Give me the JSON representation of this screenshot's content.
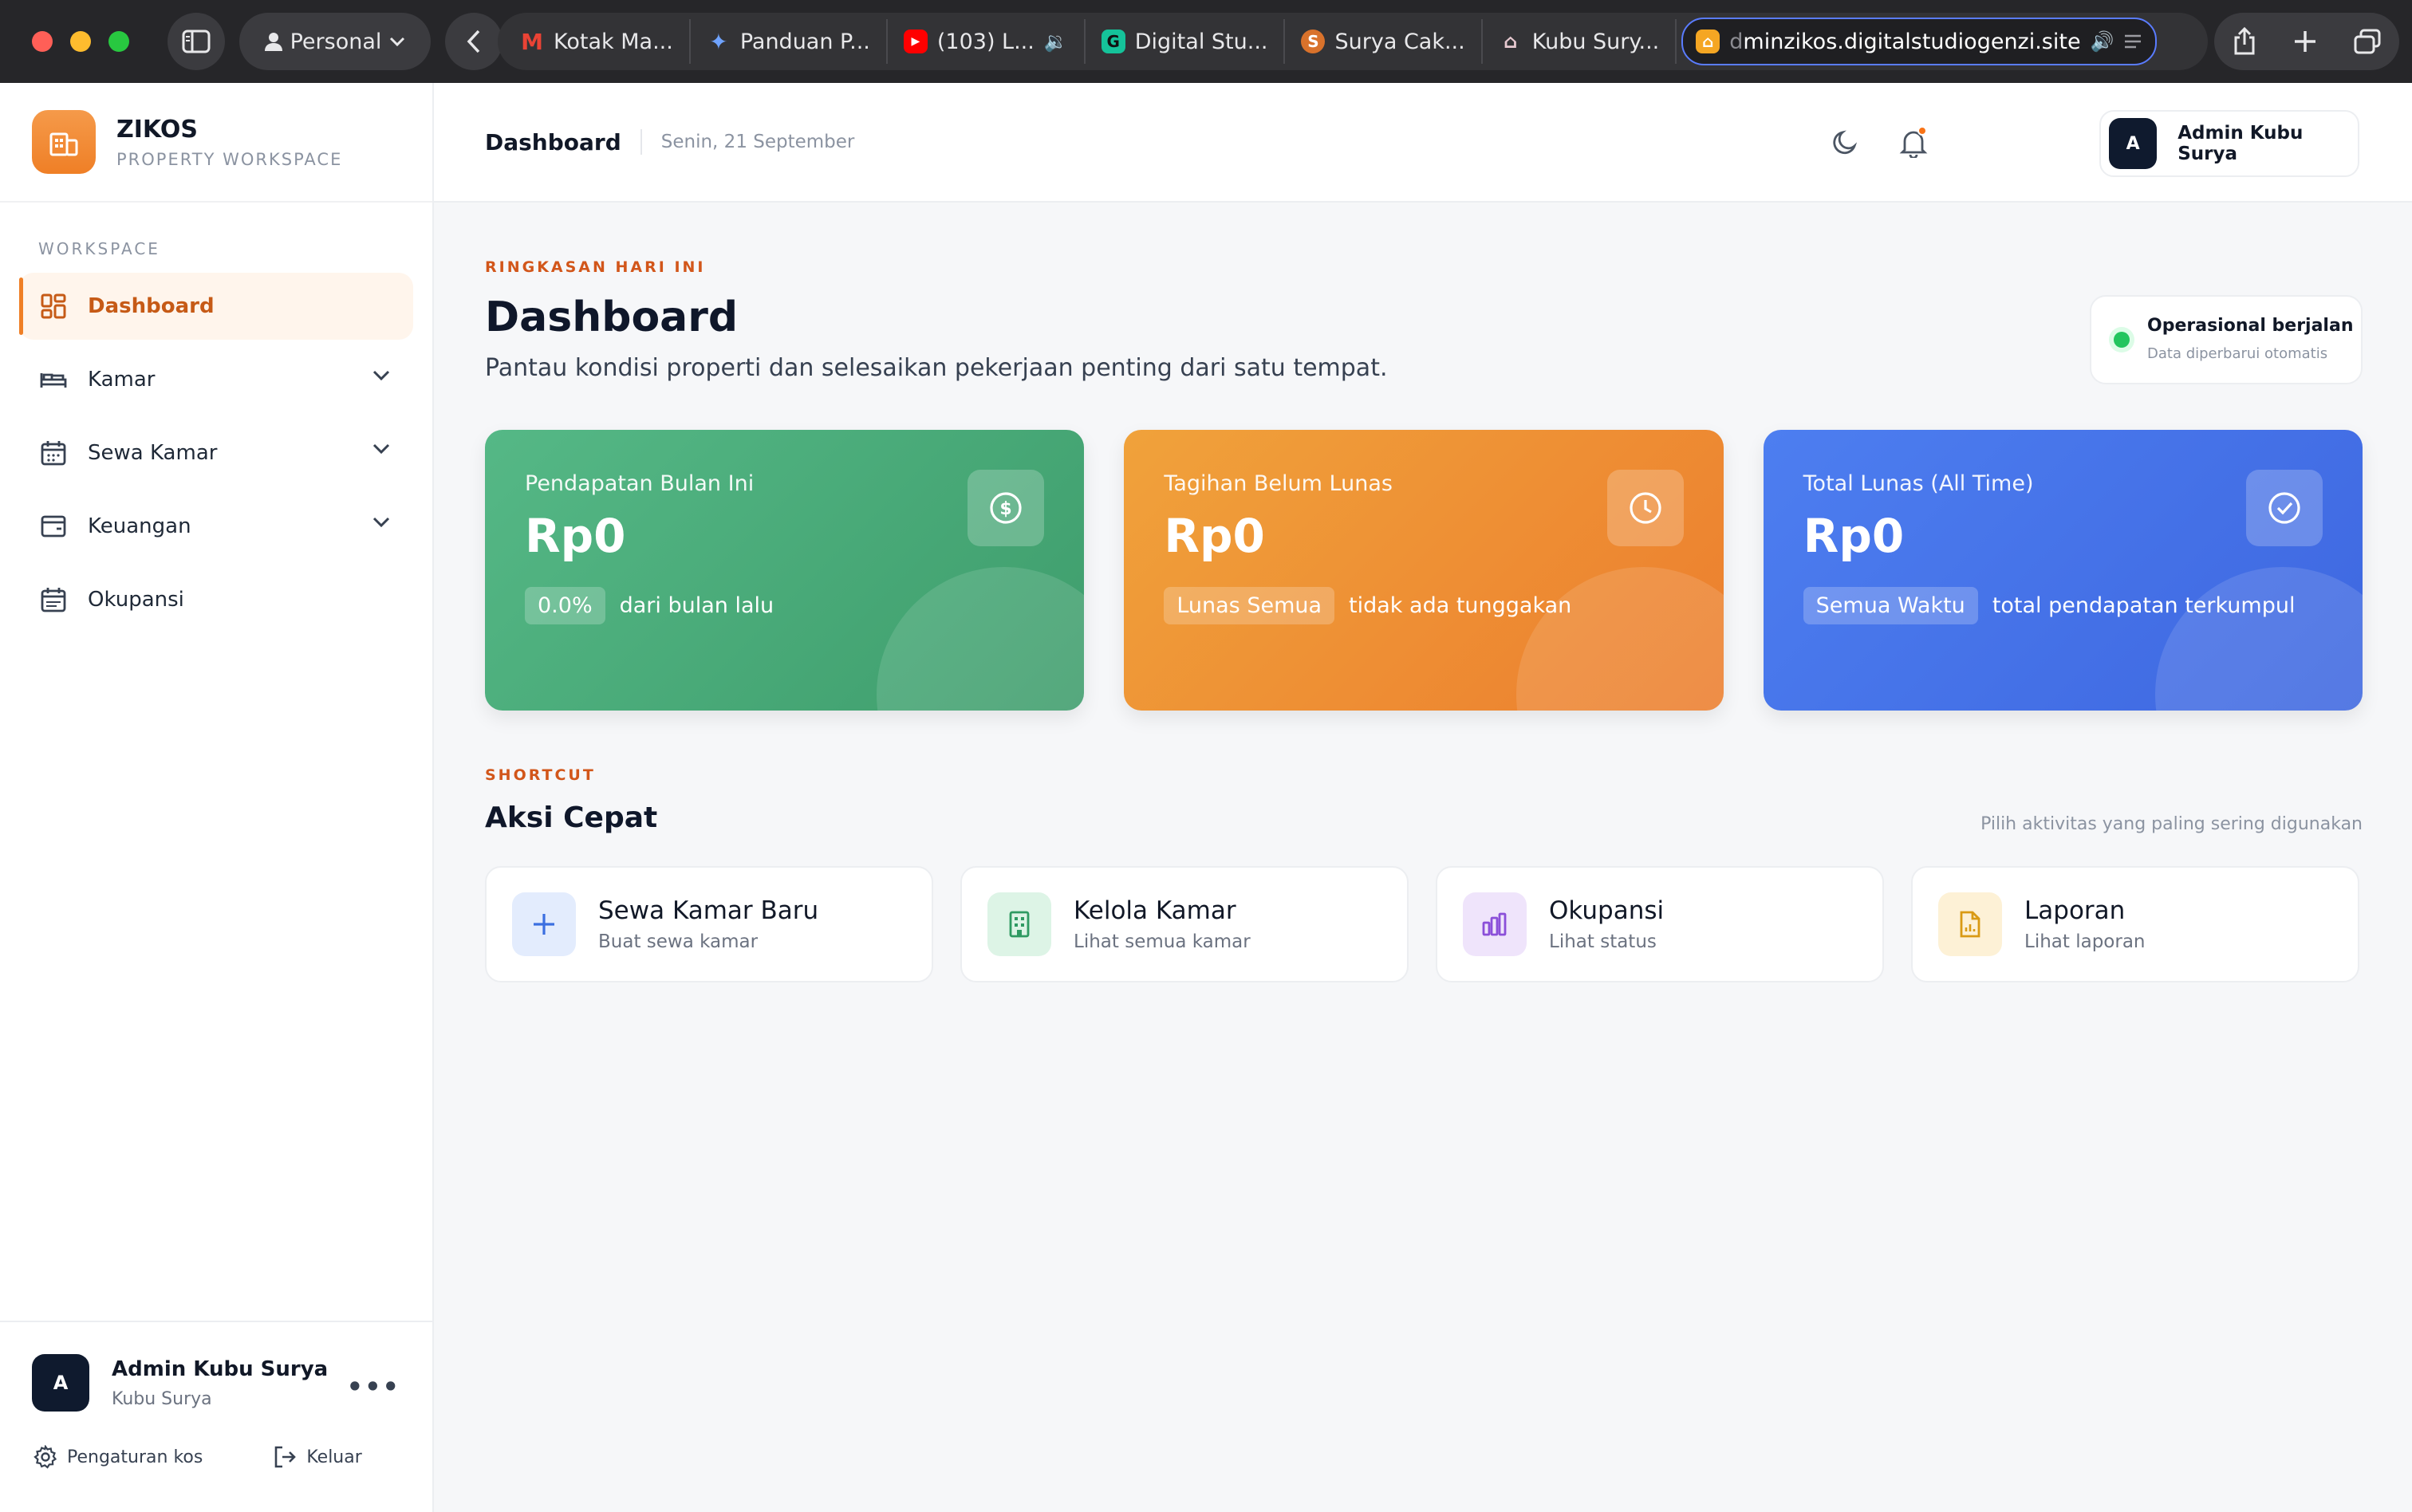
{
  "browser": {
    "profile_label": "Personal",
    "tabs": [
      {
        "label": "Kotak Ma...",
        "icon": "gmail-icon"
      },
      {
        "label": "Panduan P...",
        "icon": "gemini-icon"
      },
      {
        "label": "(103) L...",
        "icon": "youtube-icon"
      },
      {
        "label": "Digital Stu...",
        "icon": "grammarly-icon"
      },
      {
        "label": "Surya Cak...",
        "icon": "site-s-icon"
      },
      {
        "label": "Kubu Sury...",
        "icon": "site-house-icon"
      }
    ],
    "url_prefix": "d",
    "url_rest": "minzikos.digitalstudiogenzi.site"
  },
  "sidebar": {
    "brand_name": "ZIKOS",
    "brand_sub": "PROPERTY WORKSPACE",
    "section_label": "WORKSPACE",
    "items": [
      {
        "label": "Dashboard",
        "icon": "grid-icon"
      },
      {
        "label": "Kamar",
        "icon": "bed-icon"
      },
      {
        "label": "Sewa Kamar",
        "icon": "calendar-icon"
      },
      {
        "label": "Keuangan",
        "icon": "wallet-icon"
      },
      {
        "label": "Okupansi",
        "icon": "calendar-grid-icon"
      }
    ],
    "user_name": "Admin Kubu Surya",
    "user_sub": "Kubu Surya",
    "avatar_letter": "A",
    "settings_label": "Pengaturan kos",
    "logout_label": "Keluar"
  },
  "header": {
    "title": "Dashboard",
    "date": "Senin, 21 September",
    "admin_name": "Admin Kubu Surya",
    "avatar_letter": "A"
  },
  "main": {
    "eyebrow": "RINGKASAN HARI INI",
    "title": "Dashboard",
    "description": "Pantau kondisi properti dan selesaikan pekerjaan penting dari satu tempat.",
    "status_title": "Operasional berjalan",
    "status_sub": "Data diperbarui otomatis",
    "stats": [
      {
        "label": "Pendapatan Bulan Ini",
        "value": "Rp0",
        "badge": "0.0%",
        "note": "dari bulan lalu",
        "color": "#4caf7d"
      },
      {
        "label": "Tagihan Belum Lunas",
        "value": "Rp0",
        "badge": "Lunas Semua",
        "note": "tidak ada tunggakan",
        "color": "#ee8a33"
      },
      {
        "label": "Total Lunas (All Time)",
        "value": "Rp0",
        "badge": "Semua Waktu",
        "note": "total pendapatan terkumpul",
        "color": "#4673e8"
      }
    ],
    "shortcut_eyebrow": "SHORTCUT",
    "shortcut_title": "Aksi Cepat",
    "shortcut_hint": "Pilih aktivitas yang paling sering digunakan",
    "actions": [
      {
        "title": "Sewa Kamar Baru",
        "sub": "Buat sewa kamar",
        "icon": "plus-icon",
        "color": "#3b6fe0"
      },
      {
        "title": "Kelola Kamar",
        "sub": "Lihat semua kamar",
        "icon": "building-icon",
        "color": "#2f9a62"
      },
      {
        "title": "Okupansi",
        "sub": "Lihat status",
        "icon": "bar-chart-icon",
        "color": "#8b4fd9"
      },
      {
        "title": "Laporan",
        "sub": "Lihat laporan",
        "icon": "report-icon",
        "color": "#d99a14"
      }
    ]
  }
}
